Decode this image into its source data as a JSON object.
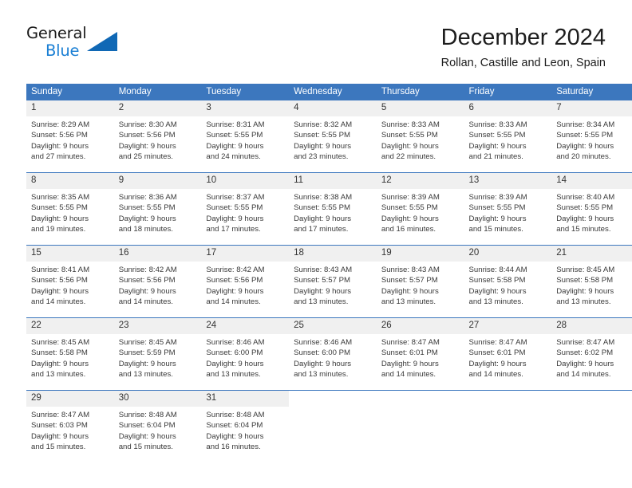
{
  "brand": {
    "name_top": "General",
    "name_bottom": "Blue",
    "triangle_icon": "blue-triangle-logo-mark",
    "colors": {
      "accent": "#1a7fd4",
      "header": "#3c77be",
      "daynum_band": "#f0f0f0"
    }
  },
  "header": {
    "title": "December 2024",
    "subtitle": "Rollan, Castille and Leon, Spain"
  },
  "weekdays": [
    "Sunday",
    "Monday",
    "Tuesday",
    "Wednesday",
    "Thursday",
    "Friday",
    "Saturday"
  ],
  "labels": {
    "sunrise_prefix": "Sunrise:",
    "sunset_prefix": "Sunset:",
    "daylight_prefix": "Daylight:"
  },
  "weeks": [
    [
      {
        "day": "1",
        "sunrise": "Sunrise: 8:29 AM",
        "sunset": "Sunset: 5:56 PM",
        "daylight_1": "Daylight: 9 hours",
        "daylight_2": "and 27 minutes."
      },
      {
        "day": "2",
        "sunrise": "Sunrise: 8:30 AM",
        "sunset": "Sunset: 5:56 PM",
        "daylight_1": "Daylight: 9 hours",
        "daylight_2": "and 25 minutes."
      },
      {
        "day": "3",
        "sunrise": "Sunrise: 8:31 AM",
        "sunset": "Sunset: 5:55 PM",
        "daylight_1": "Daylight: 9 hours",
        "daylight_2": "and 24 minutes."
      },
      {
        "day": "4",
        "sunrise": "Sunrise: 8:32 AM",
        "sunset": "Sunset: 5:55 PM",
        "daylight_1": "Daylight: 9 hours",
        "daylight_2": "and 23 minutes."
      },
      {
        "day": "5",
        "sunrise": "Sunrise: 8:33 AM",
        "sunset": "Sunset: 5:55 PM",
        "daylight_1": "Daylight: 9 hours",
        "daylight_2": "and 22 minutes."
      },
      {
        "day": "6",
        "sunrise": "Sunrise: 8:33 AM",
        "sunset": "Sunset: 5:55 PM",
        "daylight_1": "Daylight: 9 hours",
        "daylight_2": "and 21 minutes."
      },
      {
        "day": "7",
        "sunrise": "Sunrise: 8:34 AM",
        "sunset": "Sunset: 5:55 PM",
        "daylight_1": "Daylight: 9 hours",
        "daylight_2": "and 20 minutes."
      }
    ],
    [
      {
        "day": "8",
        "sunrise": "Sunrise: 8:35 AM",
        "sunset": "Sunset: 5:55 PM",
        "daylight_1": "Daylight: 9 hours",
        "daylight_2": "and 19 minutes."
      },
      {
        "day": "9",
        "sunrise": "Sunrise: 8:36 AM",
        "sunset": "Sunset: 5:55 PM",
        "daylight_1": "Daylight: 9 hours",
        "daylight_2": "and 18 minutes."
      },
      {
        "day": "10",
        "sunrise": "Sunrise: 8:37 AM",
        "sunset": "Sunset: 5:55 PM",
        "daylight_1": "Daylight: 9 hours",
        "daylight_2": "and 17 minutes."
      },
      {
        "day": "11",
        "sunrise": "Sunrise: 8:38 AM",
        "sunset": "Sunset: 5:55 PM",
        "daylight_1": "Daylight: 9 hours",
        "daylight_2": "and 17 minutes."
      },
      {
        "day": "12",
        "sunrise": "Sunrise: 8:39 AM",
        "sunset": "Sunset: 5:55 PM",
        "daylight_1": "Daylight: 9 hours",
        "daylight_2": "and 16 minutes."
      },
      {
        "day": "13",
        "sunrise": "Sunrise: 8:39 AM",
        "sunset": "Sunset: 5:55 PM",
        "daylight_1": "Daylight: 9 hours",
        "daylight_2": "and 15 minutes."
      },
      {
        "day": "14",
        "sunrise": "Sunrise: 8:40 AM",
        "sunset": "Sunset: 5:55 PM",
        "daylight_1": "Daylight: 9 hours",
        "daylight_2": "and 15 minutes."
      }
    ],
    [
      {
        "day": "15",
        "sunrise": "Sunrise: 8:41 AM",
        "sunset": "Sunset: 5:56 PM",
        "daylight_1": "Daylight: 9 hours",
        "daylight_2": "and 14 minutes."
      },
      {
        "day": "16",
        "sunrise": "Sunrise: 8:42 AM",
        "sunset": "Sunset: 5:56 PM",
        "daylight_1": "Daylight: 9 hours",
        "daylight_2": "and 14 minutes."
      },
      {
        "day": "17",
        "sunrise": "Sunrise: 8:42 AM",
        "sunset": "Sunset: 5:56 PM",
        "daylight_1": "Daylight: 9 hours",
        "daylight_2": "and 14 minutes."
      },
      {
        "day": "18",
        "sunrise": "Sunrise: 8:43 AM",
        "sunset": "Sunset: 5:57 PM",
        "daylight_1": "Daylight: 9 hours",
        "daylight_2": "and 13 minutes."
      },
      {
        "day": "19",
        "sunrise": "Sunrise: 8:43 AM",
        "sunset": "Sunset: 5:57 PM",
        "daylight_1": "Daylight: 9 hours",
        "daylight_2": "and 13 minutes."
      },
      {
        "day": "20",
        "sunrise": "Sunrise: 8:44 AM",
        "sunset": "Sunset: 5:58 PM",
        "daylight_1": "Daylight: 9 hours",
        "daylight_2": "and 13 minutes."
      },
      {
        "day": "21",
        "sunrise": "Sunrise: 8:45 AM",
        "sunset": "Sunset: 5:58 PM",
        "daylight_1": "Daylight: 9 hours",
        "daylight_2": "and 13 minutes."
      }
    ],
    [
      {
        "day": "22",
        "sunrise": "Sunrise: 8:45 AM",
        "sunset": "Sunset: 5:58 PM",
        "daylight_1": "Daylight: 9 hours",
        "daylight_2": "and 13 minutes."
      },
      {
        "day": "23",
        "sunrise": "Sunrise: 8:45 AM",
        "sunset": "Sunset: 5:59 PM",
        "daylight_1": "Daylight: 9 hours",
        "daylight_2": "and 13 minutes."
      },
      {
        "day": "24",
        "sunrise": "Sunrise: 8:46 AM",
        "sunset": "Sunset: 6:00 PM",
        "daylight_1": "Daylight: 9 hours",
        "daylight_2": "and 13 minutes."
      },
      {
        "day": "25",
        "sunrise": "Sunrise: 8:46 AM",
        "sunset": "Sunset: 6:00 PM",
        "daylight_1": "Daylight: 9 hours",
        "daylight_2": "and 13 minutes."
      },
      {
        "day": "26",
        "sunrise": "Sunrise: 8:47 AM",
        "sunset": "Sunset: 6:01 PM",
        "daylight_1": "Daylight: 9 hours",
        "daylight_2": "and 14 minutes."
      },
      {
        "day": "27",
        "sunrise": "Sunrise: 8:47 AM",
        "sunset": "Sunset: 6:01 PM",
        "daylight_1": "Daylight: 9 hours",
        "daylight_2": "and 14 minutes."
      },
      {
        "day": "28",
        "sunrise": "Sunrise: 8:47 AM",
        "sunset": "Sunset: 6:02 PM",
        "daylight_1": "Daylight: 9 hours",
        "daylight_2": "and 14 minutes."
      }
    ],
    [
      {
        "day": "29",
        "sunrise": "Sunrise: 8:47 AM",
        "sunset": "Sunset: 6:03 PM",
        "daylight_1": "Daylight: 9 hours",
        "daylight_2": "and 15 minutes."
      },
      {
        "day": "30",
        "sunrise": "Sunrise: 8:48 AM",
        "sunset": "Sunset: 6:04 PM",
        "daylight_1": "Daylight: 9 hours",
        "daylight_2": "and 15 minutes."
      },
      {
        "day": "31",
        "sunrise": "Sunrise: 8:48 AM",
        "sunset": "Sunset: 6:04 PM",
        "daylight_1": "Daylight: 9 hours",
        "daylight_2": "and 16 minutes."
      },
      {
        "day": "",
        "sunrise": "",
        "sunset": "",
        "daylight_1": "",
        "daylight_2": ""
      },
      {
        "day": "",
        "sunrise": "",
        "sunset": "",
        "daylight_1": "",
        "daylight_2": ""
      },
      {
        "day": "",
        "sunrise": "",
        "sunset": "",
        "daylight_1": "",
        "daylight_2": ""
      },
      {
        "day": "",
        "sunrise": "",
        "sunset": "",
        "daylight_1": "",
        "daylight_2": ""
      }
    ]
  ]
}
